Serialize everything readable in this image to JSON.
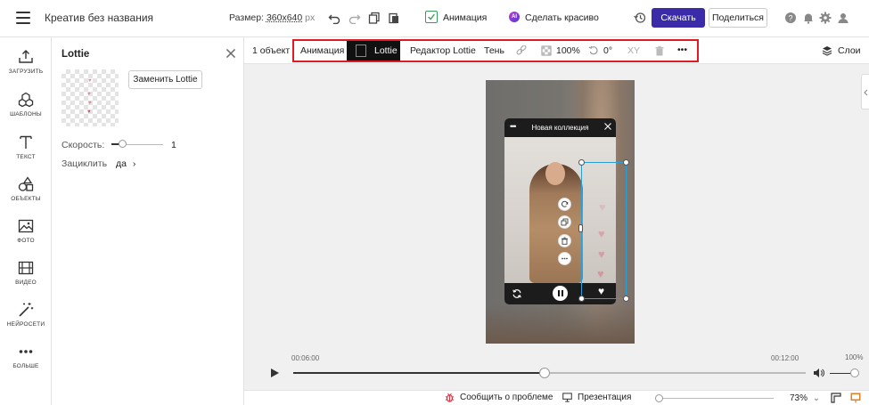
{
  "header": {
    "menu_icon": "hamburger-icon",
    "title": "Креатив без названия",
    "size_prefix": "Размер:",
    "size_value": "360x640",
    "size_unit": "px",
    "animation_label": "Анимация",
    "ai_badge": "AI",
    "beautify_label": "Сделать красиво",
    "download_label": "Скачать",
    "share_label": "Поделиться",
    "accent_color": "#3c2ba8"
  },
  "rail": {
    "items": [
      {
        "label": "ЗАГРУЗИТЬ",
        "icon": "upload-icon"
      },
      {
        "label": "ШАБЛОНЫ",
        "icon": "templates-icon"
      },
      {
        "label": "ТЕКСТ",
        "icon": "text-icon"
      },
      {
        "label": "ОБЪЕКТЫ",
        "icon": "shapes-icon"
      },
      {
        "label": "ФОТО",
        "icon": "photo-icon"
      },
      {
        "label": "ВИДЕО",
        "icon": "video-icon"
      },
      {
        "label": "НЕЙРОСЕТИ",
        "icon": "magic-wand-icon"
      },
      {
        "label": "БОЛЬШЕ",
        "icon": "more-dots-icon"
      }
    ]
  },
  "panel": {
    "title": "Lottie",
    "replace_label": "Заменить Lottie",
    "speed_label": "Скорость:",
    "speed_value": "1",
    "loop_label": "Зациклить",
    "loop_value": "да",
    "loop_chevron": "›"
  },
  "context_bar": {
    "object_count": "1 объект",
    "animation_tab": "Анимация",
    "lottie_tab": "Lottie",
    "lottie_editor": "Редактор Lottie",
    "shadow": "Тень",
    "opacity_value": "100%",
    "rotation_value": "0°",
    "xy_label": "XY",
    "more": "•••",
    "layers_label": "Слои",
    "highlight_color": "#e01b24"
  },
  "widget": {
    "title": "Новая коллекция",
    "dots": "•••"
  },
  "timeline": {
    "current_time": "00:06:00",
    "total_time": "00:12:00",
    "volume_pct": "100%",
    "progress": 0.49,
    "volume": 1.0
  },
  "statusbar": {
    "report_label": "Сообщить о проблеме",
    "present_label": "Презентация",
    "zoom_value": "73%",
    "zoom_caret": "⌄"
  }
}
